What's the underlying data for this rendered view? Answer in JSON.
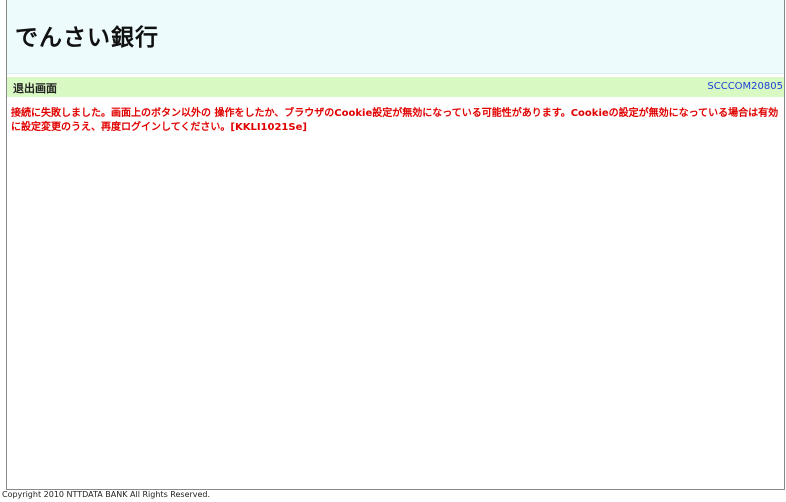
{
  "header": {
    "bank_name": "でんさい銀行"
  },
  "title_bar": {
    "screen_title": "退出画面",
    "screen_id": "SCCCOM20805"
  },
  "message": {
    "text": "接続に失敗しました。画面上のボタン以外の 操作をしたか、ブラウザのCookie設定が無効になっている可能性があります。Cookieの設定が無効になっている場合は有効に設定変更のうえ、再度ログインしてください。[KKLI1021Se]"
  },
  "footer": {
    "copyright": "Copyright 2010 NTTDATA BANK All Rights Reserved."
  },
  "colors": {
    "header_bg": "#edfbfd",
    "title_bar_bg": "#d9f9c2",
    "error_text": "#e10000",
    "screen_id_text": "#1a3fd6"
  }
}
